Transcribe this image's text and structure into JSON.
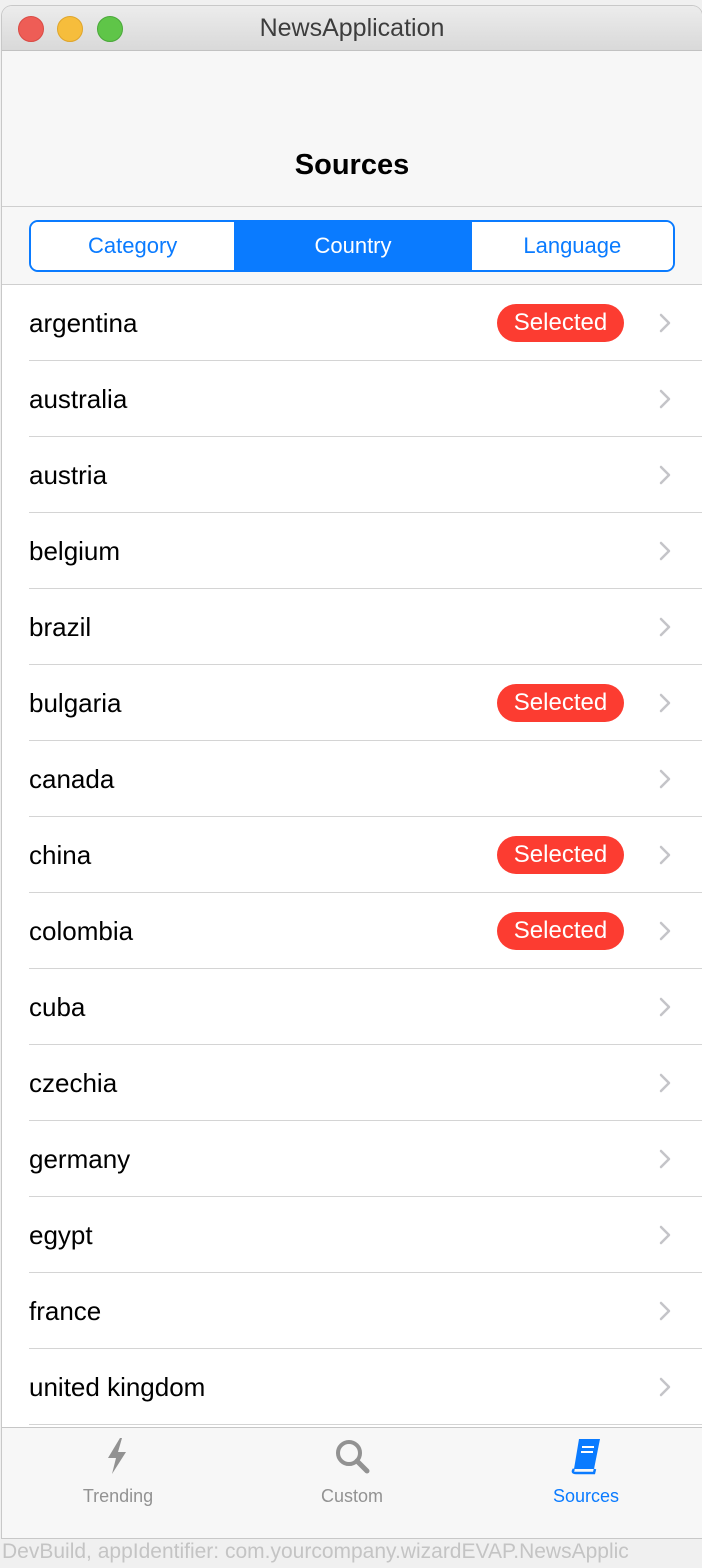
{
  "window": {
    "title": "NewsApplication"
  },
  "nav": {
    "title": "Sources"
  },
  "segments": {
    "category": "Category",
    "country": "Country",
    "language": "Language",
    "selected": "Country"
  },
  "rows": [
    {
      "label": "argentina",
      "badge": "Selected"
    },
    {
      "label": "australia",
      "badge": ""
    },
    {
      "label": "austria",
      "badge": ""
    },
    {
      "label": "belgium",
      "badge": ""
    },
    {
      "label": "brazil",
      "badge": ""
    },
    {
      "label": "bulgaria",
      "badge": "Selected"
    },
    {
      "label": "canada",
      "badge": ""
    },
    {
      "label": "china",
      "badge": "Selected"
    },
    {
      "label": "colombia",
      "badge": "Selected"
    },
    {
      "label": "cuba",
      "badge": ""
    },
    {
      "label": "czechia",
      "badge": ""
    },
    {
      "label": "germany",
      "badge": ""
    },
    {
      "label": "egypt",
      "badge": ""
    },
    {
      "label": "france",
      "badge": ""
    },
    {
      "label": "united kingdom",
      "badge": ""
    }
  ],
  "tabs": {
    "trending": "Trending",
    "custom": "Custom",
    "sources": "Sources",
    "active": "Sources"
  },
  "footer": {
    "text": "DevBuild, appIdentifier: com.yourcompany.wizardEVAP.NewsApplic"
  },
  "colors": {
    "accent": "#0a7bff",
    "badge": "#fc3c31",
    "inactive": "#929292"
  },
  "icons": {
    "trending": "lightning-bolt-icon",
    "custom": "magnifier-icon",
    "sources": "book-icon",
    "disclosure": "chevron-right-icon"
  }
}
